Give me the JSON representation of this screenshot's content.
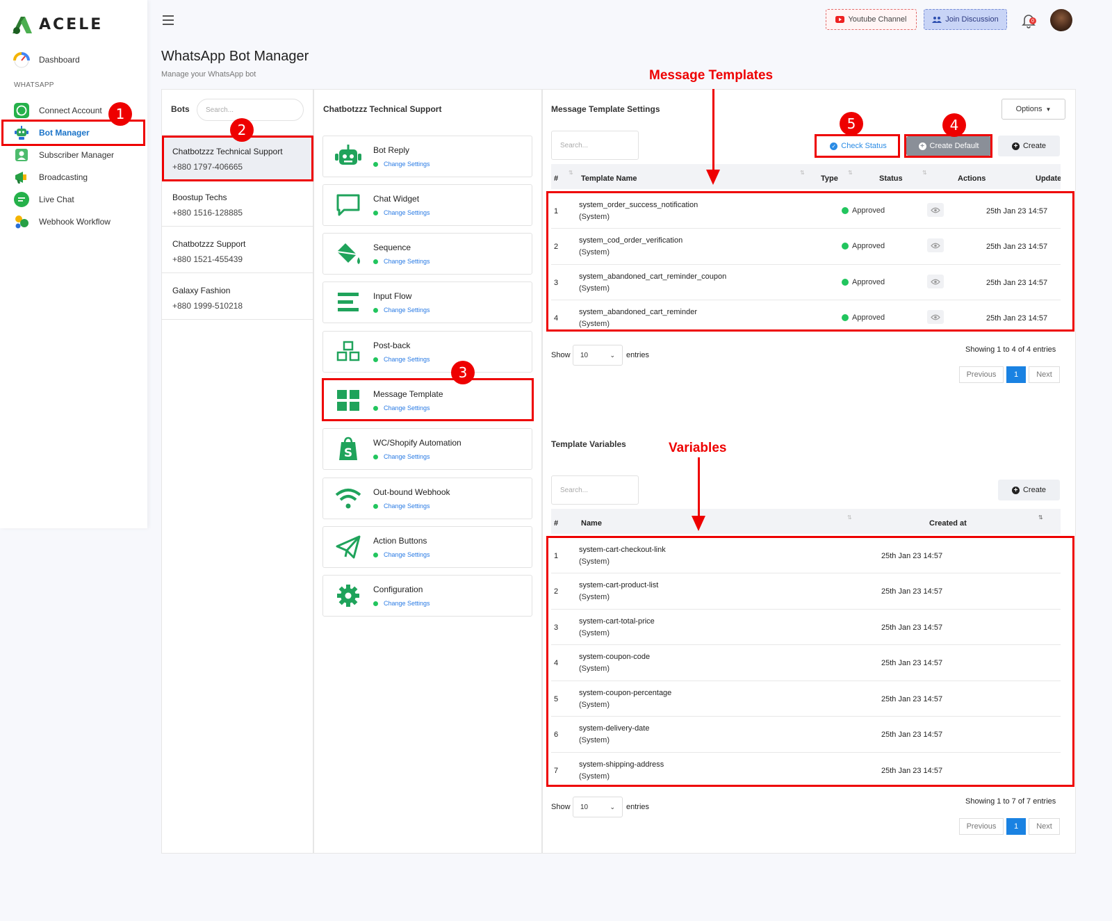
{
  "app": {
    "logo_text": "ACELE"
  },
  "sidebar": {
    "items": [
      {
        "label": "Dashboard",
        "icon": "dashboard-gauge-icon"
      },
      {
        "label": "Connect Account",
        "icon": "whatsapp-icon"
      },
      {
        "label": "Bot Manager",
        "icon": "bot-icon",
        "active": true
      },
      {
        "label": "Subscriber Manager",
        "icon": "subscriber-icon"
      },
      {
        "label": "Broadcasting",
        "icon": "megaphone-icon"
      },
      {
        "label": "Live Chat",
        "icon": "chat-icon"
      },
      {
        "label": "Webhook Workflow",
        "icon": "webhook-icon"
      }
    ],
    "section_label": "WHATSAPP"
  },
  "header": {
    "youtube_label": "Youtube Channel",
    "join_label": "Join Discussion",
    "notification_count": "0",
    "page_title": "WhatsApp Bot Manager",
    "page_subtitle": "Manage your WhatsApp bot"
  },
  "bots": {
    "label": "Bots",
    "search_placeholder": "Search...",
    "items": [
      {
        "name": "Chatbotzzz Technical Support",
        "phone": "+880 1797-406665",
        "active": true
      },
      {
        "name": "Boostup Techs",
        "phone": "+880 1516-128885"
      },
      {
        "name": "Chatbotzzz Support",
        "phone": "+880 1521-455439"
      },
      {
        "name": "Galaxy Fashion",
        "phone": "+880 1999-510218"
      }
    ]
  },
  "menu": {
    "title": "Chatbotzzz Technical Support",
    "change_label": "Change Settings",
    "items": [
      {
        "label": "Bot Reply",
        "icon": "robot-icon"
      },
      {
        "label": "Chat Widget",
        "icon": "chat-bubble-icon"
      },
      {
        "label": "Sequence",
        "icon": "paint-bucket-icon"
      },
      {
        "label": "Input Flow",
        "icon": "align-lines-icon"
      },
      {
        "label": "Post-back",
        "icon": "cubes-icon"
      },
      {
        "label": "Message Template",
        "icon": "grid-icon"
      },
      {
        "label": "WC/Shopify Automation",
        "icon": "shopify-icon"
      },
      {
        "label": "Out-bound Webhook",
        "icon": "wifi-icon"
      },
      {
        "label": "Action Buttons",
        "icon": "paper-plane-icon"
      },
      {
        "label": "Configuration",
        "icon": "gear-icon"
      }
    ]
  },
  "templates": {
    "title": "Message Template Settings",
    "options_label": "Options",
    "search_placeholder": "Search...",
    "check_status_label": "Check Status",
    "create_default_label": "Create Default",
    "create_label": "Create",
    "columns": [
      "#",
      "Template Name",
      "Type",
      "Status",
      "Actions",
      "Update"
    ],
    "rows": [
      {
        "n": "1",
        "name": "system_order_success_notification",
        "type": "(System)",
        "status": "Approved",
        "updated": "25th Jan 23 14:57"
      },
      {
        "n": "2",
        "name": "system_cod_order_verification",
        "type": "(System)",
        "status": "Approved",
        "updated": "25th Jan 23 14:57"
      },
      {
        "n": "3",
        "name": "system_abandoned_cart_reminder_coupon",
        "type": "(System)",
        "status": "Approved",
        "updated": "25th Jan 23 14:57"
      },
      {
        "n": "4",
        "name": "system_abandoned_cart_reminder",
        "type": "(System)",
        "status": "Approved",
        "updated": "25th Jan 23 14:57"
      }
    ],
    "show_label": "Show",
    "entries_label": "entries",
    "page_size": "10",
    "showing": "Showing 1 to 4 of 4 entries",
    "prev_label": "Previous",
    "page": "1",
    "next_label": "Next"
  },
  "variables": {
    "title": "Template Variables",
    "search_placeholder": "Search...",
    "create_label": "Create",
    "columns": [
      "#",
      "Name",
      "Created at"
    ],
    "rows": [
      {
        "n": "1",
        "name": "system-cart-checkout-link",
        "type": "(System)",
        "created": "25th Jan 23 14:57"
      },
      {
        "n": "2",
        "name": "system-cart-product-list",
        "type": "(System)",
        "created": "25th Jan 23 14:57"
      },
      {
        "n": "3",
        "name": "system-cart-total-price",
        "type": "(System)",
        "created": "25th Jan 23 14:57"
      },
      {
        "n": "4",
        "name": "system-coupon-code",
        "type": "(System)",
        "created": "25th Jan 23 14:57"
      },
      {
        "n": "5",
        "name": "system-coupon-percentage",
        "type": "(System)",
        "created": "25th Jan 23 14:57"
      },
      {
        "n": "6",
        "name": "system-delivery-date",
        "type": "(System)",
        "created": "25th Jan 23 14:57"
      },
      {
        "n": "7",
        "name": "system-shipping-address",
        "type": "(System)",
        "created": "25th Jan 23 14:57"
      }
    ],
    "show_label": "Show",
    "entries_label": "entries",
    "page_size": "10",
    "showing": "Showing 1 to 7 of 7 entries",
    "prev_label": "Previous",
    "page": "1",
    "next_label": "Next"
  },
  "annotations": {
    "badges": [
      "1",
      "2",
      "3",
      "4",
      "5"
    ],
    "message_templates_label": "Message Templates",
    "variables_label": "Variables",
    "color": "#e00000"
  },
  "colors": {
    "accent": "#1a82e2",
    "brand_green": "#1fa35b",
    "approved": "#22c55e"
  }
}
